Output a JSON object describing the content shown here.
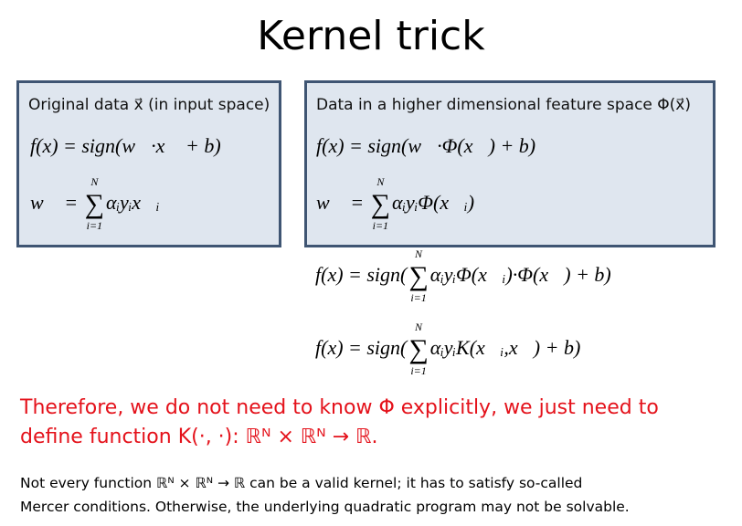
{
  "title": "Kernel trick",
  "left_box": {
    "heading": "Original data x⃗ (in input space)",
    "eq1": "f(x) = sign(w⃗·x⃗ + b)",
    "eq2_lhs": "w⃗ = ",
    "eq2_rhs": "αᵢyᵢx⃗ᵢ"
  },
  "right_box": {
    "heading": "Data in a higher dimensional feature space Φ(x⃗)",
    "eq1": "f(x) = sign(w⃗·Φ(x⃗) + b)",
    "eq2_lhs": "w⃗ = ",
    "eq2_rhs": "αᵢyᵢΦ(x⃗ᵢ)"
  },
  "sum_top": "N",
  "sum_bottom": "i=1",
  "eq3_pre": "f(x) = sign(",
  "eq3_post": "αᵢyᵢΦ(x⃗ᵢ)·Φ(x⃗) + b)",
  "eq4_pre": "f(x) = sign(",
  "eq4_post": "αᵢyᵢK(x⃗ᵢ,x⃗) + b)",
  "red_line1": "Therefore, we do not need to know Φ explicitly, we just need to",
  "red_line2": "define function K(·, ·): ℝᴺ × ℝᴺ → ℝ.",
  "note_line1": "Not every function ℝᴺ × ℝᴺ → ℝ  can be a valid kernel; it has to satisfy so-called",
  "note_line2": "Mercer conditions. Otherwise, the underlying quadratic program may not be solvable."
}
